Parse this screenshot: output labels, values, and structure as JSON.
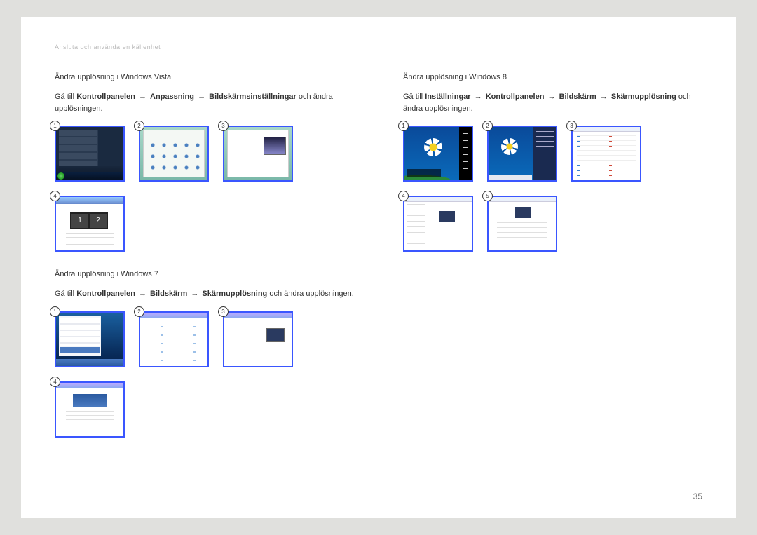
{
  "header": "Ansluta och använda en källenhet",
  "page_number": "35",
  "arrow": "→",
  "left": {
    "vista": {
      "title": "Ändra upplösning i Windows Vista",
      "instr_prefix": "Gå till ",
      "path": [
        "Kontrollpanelen",
        "Anpassning",
        "Bildskärmsinställningar"
      ],
      "instr_suffix": " och ändra upplösningen.",
      "badges": [
        "1",
        "2",
        "3",
        "4"
      ]
    },
    "win7": {
      "title": "Ändra upplösning i Windows 7",
      "instr_prefix": "Gå till ",
      "path": [
        "Kontrollpanelen",
        "Bildskärm",
        "Skärmupplösning"
      ],
      "instr_suffix": " och ändra upplösningen.",
      "badges": [
        "1",
        "2",
        "3",
        "4"
      ]
    }
  },
  "right": {
    "win8": {
      "title": "Ändra upplösning i Windows 8",
      "instr_prefix": "Gå till ",
      "path": [
        "Inställningar",
        "Kontrollpanelen",
        "Bildskärm",
        "Skärmupplösning"
      ],
      "instr_suffix": " och ändra upplösningen.",
      "badges": [
        "1",
        "2",
        "3",
        "4",
        "5"
      ]
    }
  },
  "monitor_labels": {
    "one": "1",
    "two": "2"
  }
}
